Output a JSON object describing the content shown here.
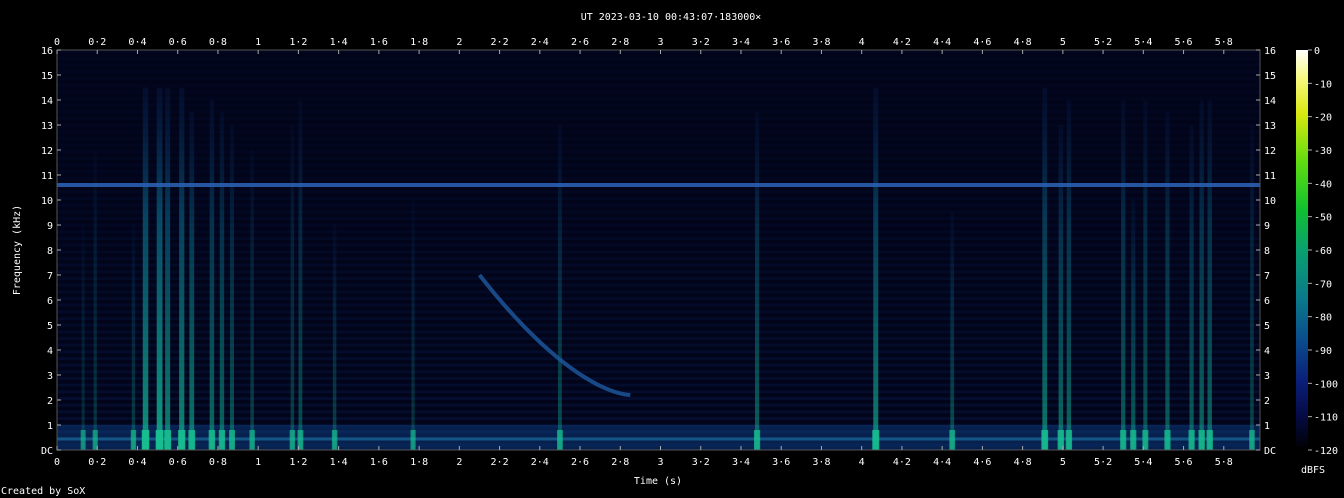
{
  "chart_data": {
    "type": "heatmap",
    "title": "UT 2023-03-10 00:43:07·183000×",
    "xlabel": "Time (s)",
    "ylabel": "Frequency (kHz)",
    "xlim": [
      0,
      5.98
    ],
    "ylim": [
      0,
      16
    ],
    "x_ticks": [
      "0",
      "0·2",
      "0·4",
      "0·6",
      "0·8",
      "1",
      "1·2",
      "1·4",
      "1·6",
      "1·8",
      "2",
      "2·2",
      "2·4",
      "2·6",
      "2·8",
      "3",
      "3·2",
      "3·4",
      "3·6",
      "3·8",
      "4",
      "4·2",
      "4·4",
      "4·6",
      "4·8",
      "5",
      "5·2",
      "5·4",
      "5·6",
      "5·8"
    ],
    "y_ticks": [
      "DC",
      "1",
      "2",
      "3",
      "4",
      "5",
      "6",
      "7",
      "8",
      "9",
      "10",
      "11",
      "12",
      "13",
      "14",
      "15",
      "16"
    ],
    "colorbar": {
      "label": "dBFS",
      "ticks": [
        "0",
        "-10",
        "-20",
        "-30",
        "-40",
        "-50",
        "-60",
        "-70",
        "-80",
        "-90",
        "-100",
        "-110",
        "-120"
      ],
      "range": [
        -120,
        0
      ]
    },
    "features": {
      "horizontal_tone_khz": 10.6,
      "background_level_dbfs": -105,
      "vertical_bursts": [
        {
          "t": 0.13,
          "f_top": 9,
          "level": -100
        },
        {
          "t": 0.19,
          "f_top": 12,
          "level": -98
        },
        {
          "t": 0.38,
          "f_top": 9,
          "level": -96
        },
        {
          "t": 0.44,
          "f_top": 14.5,
          "level": -75
        },
        {
          "t": 0.51,
          "f_top": 14.5,
          "level": -72
        },
        {
          "t": 0.55,
          "f_top": 14.5,
          "level": -80
        },
        {
          "t": 0.62,
          "f_top": 14.5,
          "level": -78
        },
        {
          "t": 0.67,
          "f_top": 13.5,
          "level": -82
        },
        {
          "t": 0.77,
          "f_top": 14,
          "level": -85
        },
        {
          "t": 0.82,
          "f_top": 13.5,
          "level": -86
        },
        {
          "t": 0.87,
          "f_top": 13,
          "level": -90
        },
        {
          "t": 0.97,
          "f_top": 12,
          "level": -95
        },
        {
          "t": 1.17,
          "f_top": 13,
          "level": -95
        },
        {
          "t": 1.21,
          "f_top": 14,
          "level": -92
        },
        {
          "t": 1.38,
          "f_top": 9,
          "level": -95
        },
        {
          "t": 1.77,
          "f_top": 10,
          "level": -98
        },
        {
          "t": 2.5,
          "f_top": 13,
          "level": -92
        },
        {
          "t": 3.48,
          "f_top": 13.5,
          "level": -88
        },
        {
          "t": 4.07,
          "f_top": 14.5,
          "level": -80
        },
        {
          "t": 4.45,
          "f_top": 9.5,
          "level": -92
        },
        {
          "t": 4.91,
          "f_top": 14.5,
          "level": -82
        },
        {
          "t": 4.99,
          "f_top": 13,
          "level": -85
        },
        {
          "t": 5.03,
          "f_top": 14,
          "level": -86
        },
        {
          "t": 5.3,
          "f_top": 14,
          "level": -88
        },
        {
          "t": 5.35,
          "f_top": 10,
          "level": -88
        },
        {
          "t": 5.41,
          "f_top": 14,
          "level": -90
        },
        {
          "t": 5.52,
          "f_top": 13.5,
          "level": -88
        },
        {
          "t": 5.64,
          "f_top": 13,
          "level": -88
        },
        {
          "t": 5.69,
          "f_top": 14,
          "level": -86
        },
        {
          "t": 5.73,
          "f_top": 14,
          "level": -86
        },
        {
          "t": 5.94,
          "f_top": 13,
          "level": -94
        }
      ],
      "descending_sweep": {
        "t_start": 2.1,
        "t_end": 2.85,
        "f_start": 7,
        "f_end": 2.2,
        "level": -96
      }
    }
  },
  "footer": {
    "credit": "Created by SoX"
  }
}
